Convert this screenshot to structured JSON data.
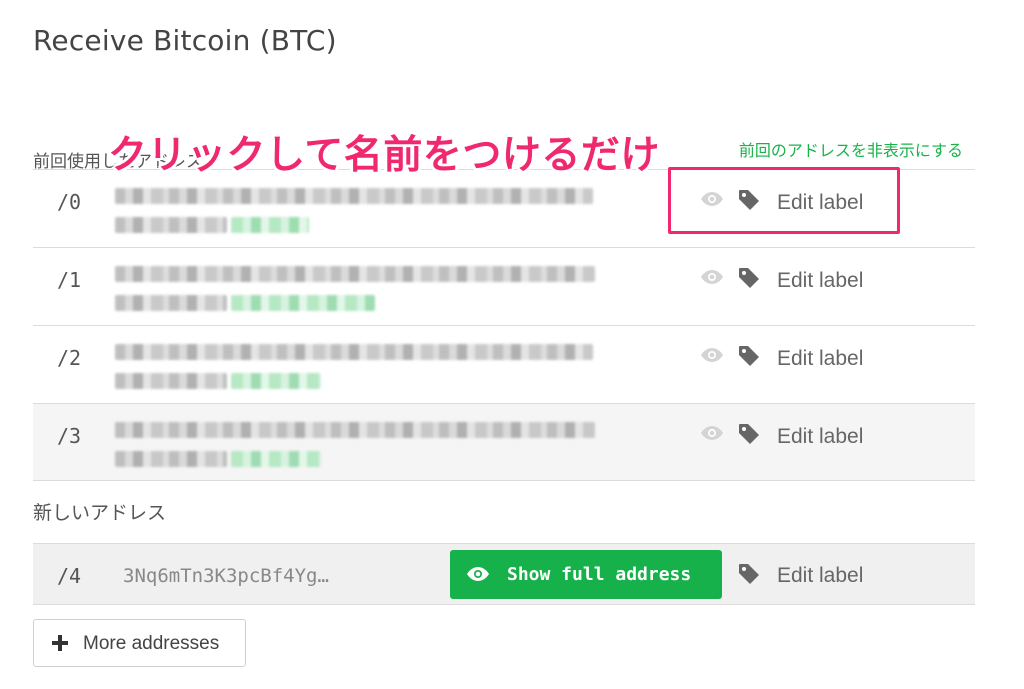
{
  "page": {
    "title": "Receive Bitcoin (BTC)"
  },
  "annotation": {
    "text": "クリックして名前をつけるだけ",
    "color": "#f0286f"
  },
  "previous": {
    "label": "前回使用したアドレス",
    "hide_link": "前回のアドレスを非表示にする",
    "rows": [
      {
        "index": "/0",
        "edit_label": "Edit label"
      },
      {
        "index": "/1",
        "edit_label": "Edit label"
      },
      {
        "index": "/2",
        "edit_label": "Edit label"
      },
      {
        "index": "/3",
        "edit_label": "Edit label"
      }
    ]
  },
  "new_address": {
    "label": "新しいアドレス",
    "index": "/4",
    "address_short": "3Nq6mTn3K3pcBf4Yg…",
    "show_full_button": "Show full address",
    "edit_label": "Edit label"
  },
  "more_button": {
    "label": "More addresses"
  },
  "colors": {
    "accent_green": "#17b14b",
    "link_green": "#19b34a",
    "annotation_pink": "#f0286f"
  },
  "icons": {
    "eye": "eye-icon",
    "tag": "tag-icon",
    "plus": "plus-icon"
  }
}
